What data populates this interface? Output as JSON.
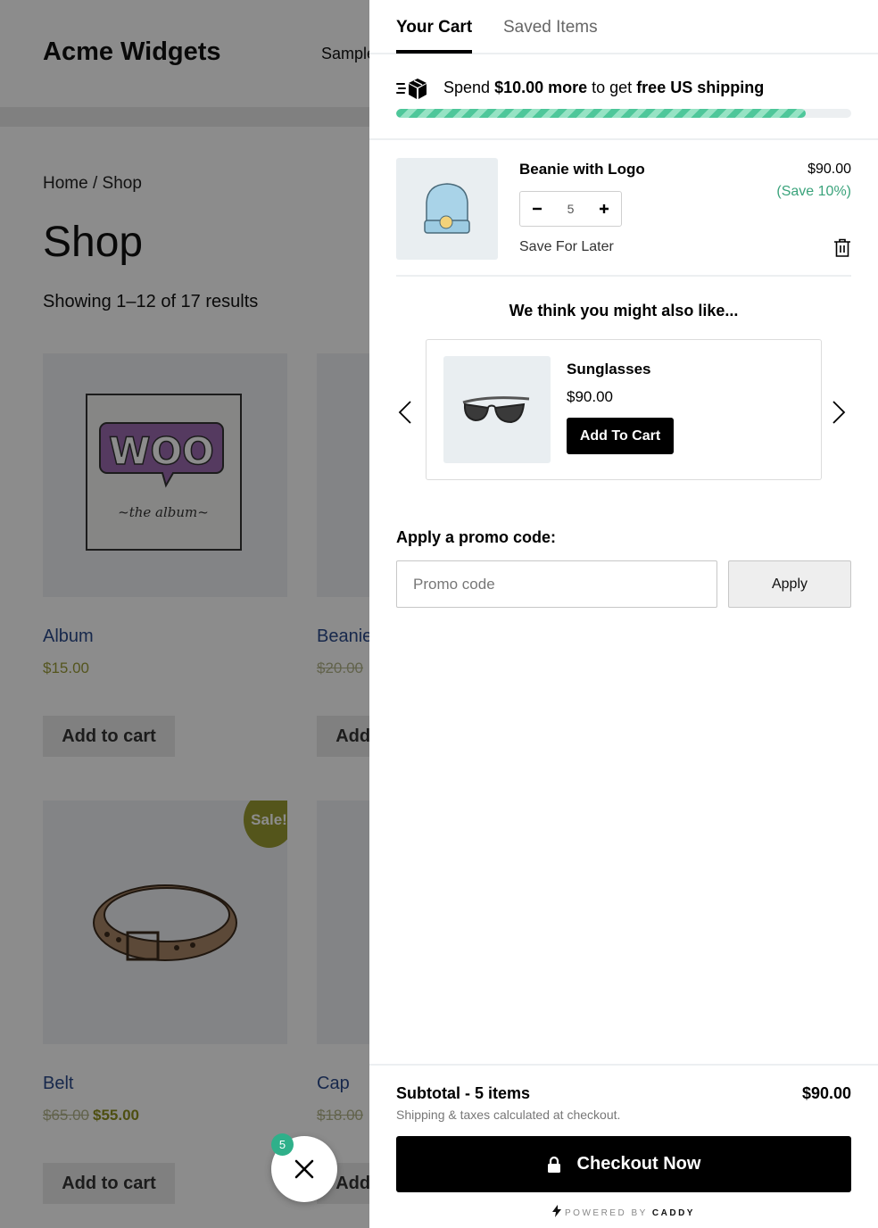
{
  "shop": {
    "site_title": "Acme Widgets",
    "nav_item": "Sample Page",
    "breadcrumb": "Home / Shop",
    "page_title": "Shop",
    "result_count": "Showing 1–12 of 17 results",
    "products": [
      {
        "name": "Album",
        "price": "$15.00",
        "button": "Add to cart"
      },
      {
        "name": "Beanie",
        "old_price": "$20.00",
        "button": "Add to cart"
      },
      {
        "name": "Belt",
        "old_price": "$65.00",
        "price": "$55.00",
        "button": "Add to cart",
        "badge": "Sale!"
      },
      {
        "name": "Cap",
        "old_price": "$18.00",
        "button": "Add to cart"
      }
    ],
    "album_art": {
      "logo": "WOO",
      "caption": "~the   album~"
    }
  },
  "bubble": {
    "count": "5",
    "icon": "close-icon"
  },
  "cart": {
    "tabs": [
      {
        "label": "Your Cart",
        "active": true
      },
      {
        "label": "Saved Items",
        "active": false
      }
    ],
    "shipping": {
      "prefix": "Spend ",
      "amount": "$10.00 more",
      "middle": " to get ",
      "goal": "free US shipping",
      "progress_fraction": 0.9,
      "icon": "package-icon"
    },
    "item": {
      "name": "Beanie with Logo",
      "price": "$90.00",
      "savings": "(Save 10%)",
      "quantity": "5",
      "save_for_later": "Save For Later"
    },
    "recommendations": {
      "title": "We think you might also like...",
      "product": {
        "name": "Sunglasses",
        "price": "$90.00",
        "button": "Add To Cart"
      }
    },
    "promo": {
      "label": "Apply a promo code:",
      "placeholder": "Promo code",
      "button": "Apply"
    },
    "footer": {
      "subtotal_label": "Subtotal - 5 items",
      "subtotal_value": "$90.00",
      "note": "Shipping & taxes calculated at checkout.",
      "checkout": "Checkout Now",
      "powered_prefix": "POWERED BY ",
      "powered_brand": "CADDY"
    },
    "colors": {
      "accent": "#4ec79a",
      "savings": "#3aa37b",
      "button": "#000000"
    }
  }
}
